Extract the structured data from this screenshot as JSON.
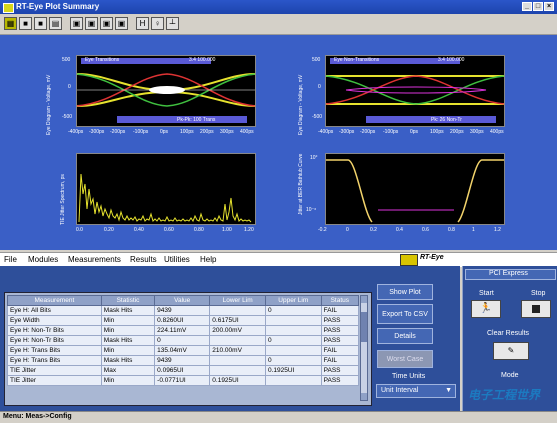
{
  "window": {
    "title": "RT-Eye Plot Summary"
  },
  "toolbar_icons": [
    "grid-icon",
    "save-icon",
    "save-all-icon",
    "print-icon",
    "layout-1-icon",
    "layout-2-icon",
    "layout-3-icon",
    "layout-4-icon",
    "cursor-h-icon",
    "marker-icon",
    "baseline-icon"
  ],
  "plots": {
    "eye_trans": {
      "label": "Eye Transitions",
      "ylabel": "Eye Diagram - Voltage, mV",
      "yticks": [
        "500",
        "0",
        "-500"
      ],
      "xticks": [
        "-400ps",
        "-300ps",
        "-200ps",
        "-100ps",
        "0ps",
        "100ps",
        "200ps",
        "300ps",
        "400ps"
      ],
      "annotation": "Pk-Pk: 100 Trans",
      "marker_text": "3.4 100.000"
    },
    "eye_nontrans": {
      "label": "Eye Non-Transitions",
      "ylabel": "Eye Diagram - Voltage, mV",
      "yticks": [
        "500",
        "0",
        "-500"
      ],
      "xticks": [
        "-400ps",
        "-300ps",
        "-200ps",
        "-100ps",
        "0ps",
        "100ps",
        "200ps",
        "300ps",
        "400ps"
      ],
      "annotation": "Pk: 26 Non-Tr",
      "marker_text": "3.4 100.000"
    },
    "tie_spectrum": {
      "ylabel": "TIE Jitter Spectrum, ps",
      "xticks": [
        "0.0",
        "0.20",
        "0.40",
        "0.60",
        "0.80",
        "1.00",
        "1.20"
      ]
    },
    "bathtub": {
      "ylabel": "Jitter at BER Bathtub Curve",
      "yticks": [
        "10°",
        "10⁻⁶"
      ],
      "xticks": [
        "-0.2",
        "0",
        "0.2",
        "0.4",
        "0.6",
        "0.8",
        "1",
        "1.2"
      ]
    }
  },
  "menu": [
    "File",
    "Modules",
    "Measurements",
    "Results",
    "Utilities",
    "Help"
  ],
  "logo": {
    "brand": "RT-Eye"
  },
  "results": {
    "columns": [
      "Measurement",
      "Statistic",
      "Value",
      "Lower Lim",
      "Upper Lim",
      "Status"
    ],
    "rows": [
      [
        "Eye H: All Bits",
        "Mask Hits",
        "9439",
        "",
        "0",
        "FAIL"
      ],
      [
        "Eye Width",
        "Min",
        "0.8260UI",
        "0.6175UI",
        "",
        "PASS"
      ],
      [
        "Eye H: Non-Tr Bits",
        "Min",
        "224.11mV",
        "200.00mV",
        "",
        "PASS"
      ],
      [
        "Eye H: Non-Tr Bits",
        "Mask Hits",
        "0",
        "",
        "0",
        "PASS"
      ],
      [
        "Eye H: Trans Bits",
        "Min",
        "135.04mV",
        "210.00mV",
        "",
        "FAIL"
      ],
      [
        "Eye H: Trans Bits",
        "Mask Hits",
        "9439",
        "",
        "0",
        "FAIL"
      ],
      [
        "TIE Jitter",
        "Max",
        "0.0965UI",
        "",
        "0.1925UI",
        "PASS"
      ],
      [
        "TIE Jitter",
        "Min",
        "-0.0771UI",
        "0.1925UI",
        "",
        "PASS"
      ]
    ]
  },
  "side_buttons": {
    "show_plot": "Show Plot",
    "export": "Export To CSV",
    "details": "Details",
    "worst_case": "Worst Case",
    "time_units_label": "Time Units",
    "time_units_value": "Unit Interval"
  },
  "pcie": {
    "title": "PCI Express",
    "start": "Start",
    "stop": "Stop",
    "clear_results": "Clear Results",
    "mode": "Mode"
  },
  "status": {
    "text": "Menu: Meas->Config"
  },
  "watermark": {
    "text": "电子工程世界"
  },
  "colors": {
    "plot_bg_blue": "#3a5fc6",
    "panel_blue": "#2e4f9a",
    "trace_yellow": "#e6e22e"
  }
}
